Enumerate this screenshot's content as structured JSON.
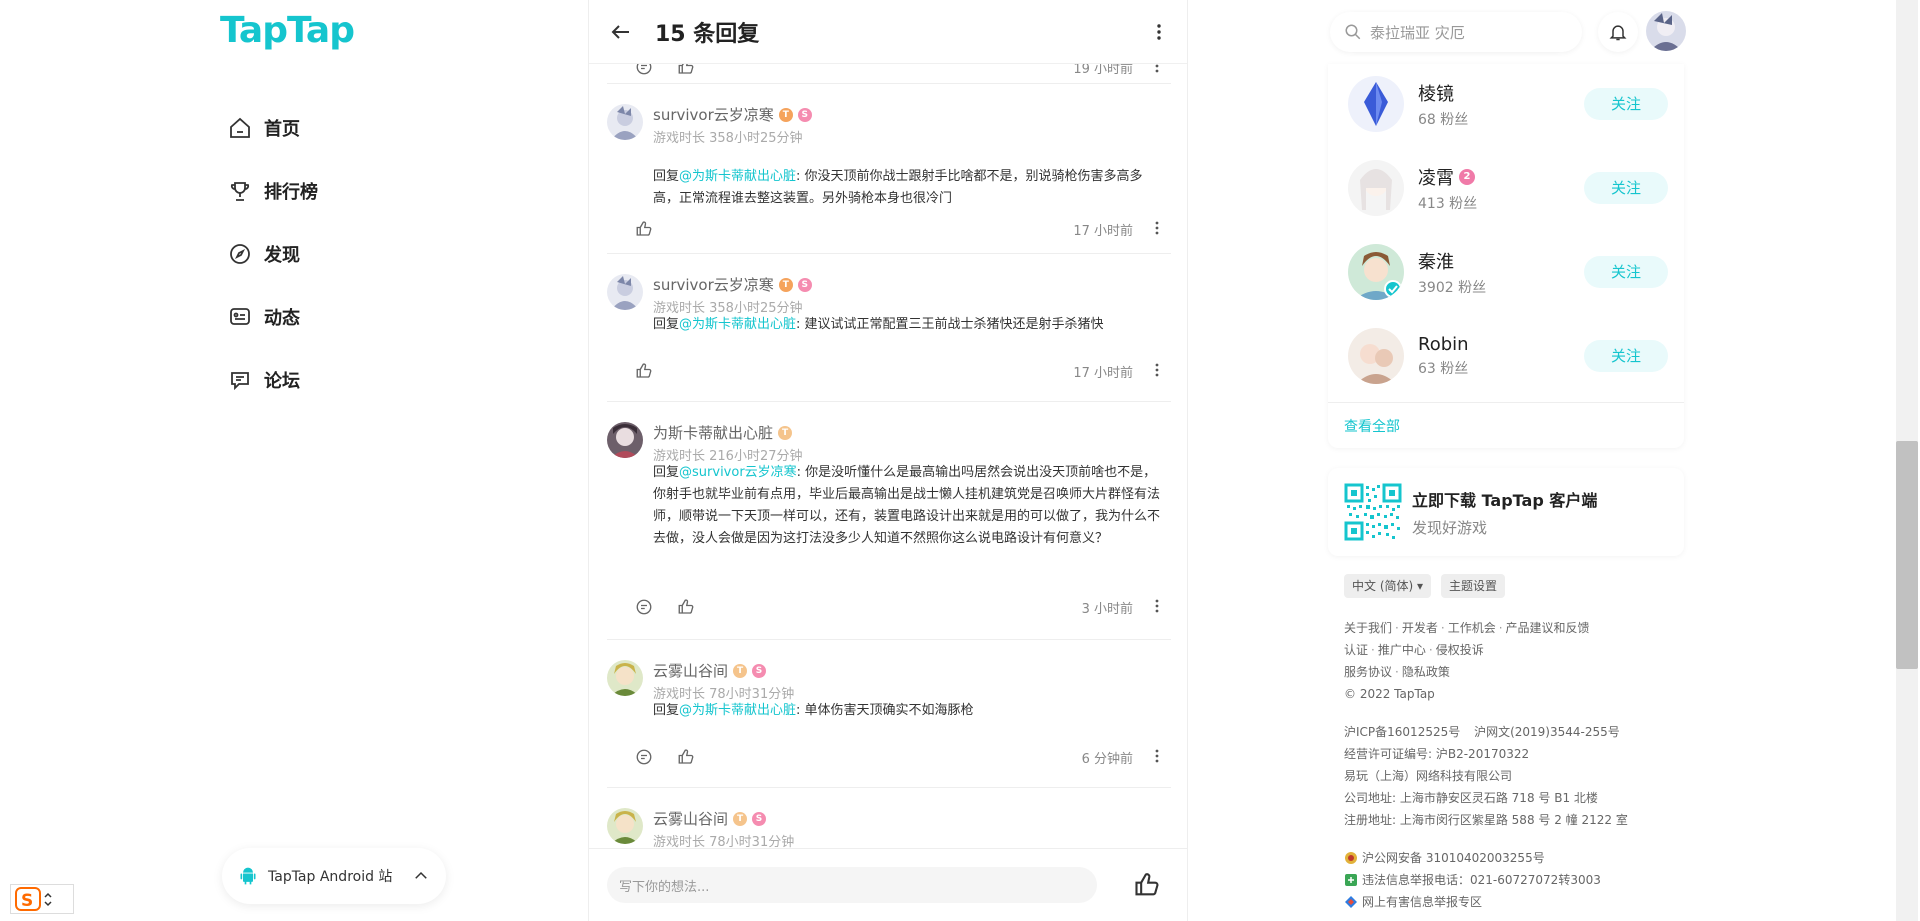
{
  "brand": {
    "logo": "TapTap",
    "accent": "#15c5ce"
  },
  "nav": [
    {
      "label": "首页",
      "icon": "home-icon"
    },
    {
      "label": "排行榜",
      "icon": "trophy-icon"
    },
    {
      "label": "发现",
      "icon": "compass-icon"
    },
    {
      "label": "动态",
      "icon": "feed-icon"
    },
    {
      "label": "论坛",
      "icon": "forum-icon"
    }
  ],
  "android_pill": {
    "label": "TapTap Android 站"
  },
  "thread": {
    "title": "15 条回复",
    "top_time": "19 小时前",
    "replies": [
      {
        "user": "survivor云岁凉寒",
        "playtime": "游戏时长 358小时25分钟",
        "reply_prefix": "回复",
        "mention": "@为斯卡蒂献出心脏",
        "body": ": 你没天顶前你战士跟射手比啥都不是，别说骑枪伤害多高多高，正常流程谁去整这装置。另外骑枪本身也很冷门",
        "time": "17 小时前"
      },
      {
        "user": "survivor云岁凉寒",
        "playtime": "游戏时长 358小时25分钟",
        "reply_prefix": "回复",
        "mention": "@为斯卡蒂献出心脏",
        "body": ": 建议试试正常配置三王前战士杀猪快还是射手杀猪快",
        "time": "17 小时前"
      },
      {
        "user": "为斯卡蒂献出心脏",
        "playtime": "游戏时长 216小时27分钟",
        "reply_prefix": "回复",
        "mention": "@survivor云岁凉寒",
        "body": ": 你是没听懂什么是最高输出吗居然会说出没天顶前啥也不是，你射手也就毕业前有点用，毕业后最高输出是战士懒人挂机建筑党是召唤师大片群怪有法师，顺带说一下天顶一样可以，还有，装置电路设计出来就是用的可以做了，我为什么不去做，没人会做是因为这打法没多少人知道不然照你这么说电路设计有何意义？",
        "time": "3 小时前"
      },
      {
        "user": "云雾山谷间",
        "playtime": "游戏时长 78小时31分钟",
        "reply_prefix": "回复",
        "mention": "@为斯卡蒂献出心脏",
        "body": ": 单体伤害天顶确实不如海豚枪",
        "time": "6 分钟前"
      },
      {
        "user": "云雾山谷间",
        "playtime": "游戏时长 78小时31分钟"
      }
    ],
    "input_placeholder": "写下你的想法..."
  },
  "search": {
    "placeholder": "泰拉瑞亚 灾厄"
  },
  "recommend": {
    "follow_label": "关注",
    "users": [
      {
        "name": "棱镜",
        "fans": "68 粉丝"
      },
      {
        "name": "凌霄",
        "fans": "413 粉丝",
        "badge": "2"
      },
      {
        "name": "秦淮",
        "fans": "3902 粉丝"
      },
      {
        "name": "Robin",
        "fans": "63 粉丝"
      }
    ],
    "see_all": "查看全部"
  },
  "download": {
    "title": "立即下载 TapTap 客户端",
    "subtitle": "发现好游戏"
  },
  "chips": {
    "language": "中文 (简体) ▾",
    "theme": "主题设置"
  },
  "footer": {
    "line1": [
      "关于我们",
      "开发者",
      "工作机会",
      "产品建议和反馈"
    ],
    "line2": [
      "认证",
      "推广中心",
      "侵权投诉"
    ],
    "line3": [
      "服务协议",
      "隐私政策"
    ],
    "copyright": "© 2022 TapTap",
    "icp": "沪ICP备16012525号",
    "culture": "沪网文(2019)3544-255号",
    "license": "经营许可证编号: 沪B2-20170322",
    "company": "易玩（上海）网络科技有限公司",
    "address1": "公司地址: 上海市静安区灵石路 718 号 B1 北楼",
    "address2": "注册地址: 上海市闵行区紫星路 588 号 2 幢 2122 室",
    "police": "沪公网安备 31010402003255号",
    "report_phone": "违法信息举报电话：021-60727072转3003",
    "report_site": "网上有害信息举报专区"
  }
}
